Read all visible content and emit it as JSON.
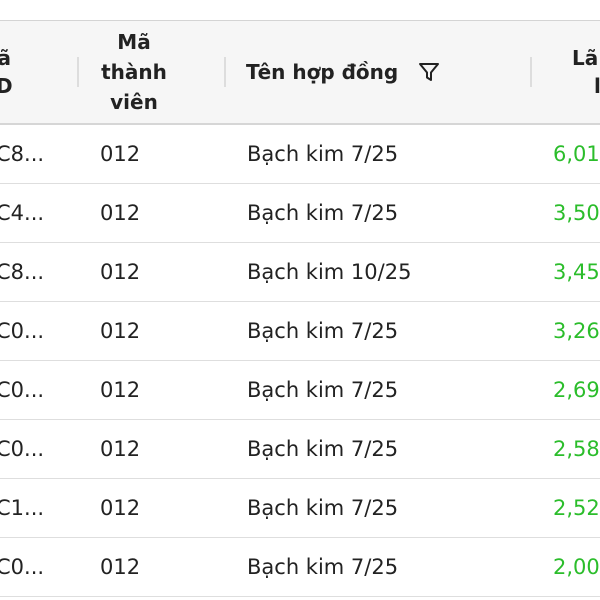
{
  "table": {
    "headers": {
      "col1_line1": "ã",
      "col1_line2": "D",
      "col2_lines": [
        "Mã",
        "thành",
        "viên"
      ],
      "col3": "Tên hợp đồng",
      "col4_line1": "Lã",
      "col4_line2": "l"
    },
    "rows": [
      {
        "id": "C8...",
        "member": "012",
        "contract": "Bạch kim 7/25",
        "profit": "6,01"
      },
      {
        "id": "C4...",
        "member": "012",
        "contract": "Bạch kim 7/25",
        "profit": "3,50"
      },
      {
        "id": "C8...",
        "member": "012",
        "contract": "Bạch kim 10/25",
        "profit": "3,45"
      },
      {
        "id": "C0...",
        "member": "012",
        "contract": "Bạch kim 7/25",
        "profit": "3,26"
      },
      {
        "id": "C0...",
        "member": "012",
        "contract": "Bạch kim 7/25",
        "profit": "2,69"
      },
      {
        "id": "C0...",
        "member": "012",
        "contract": "Bạch kim 7/25",
        "profit": "2,58"
      },
      {
        "id": "C1...",
        "member": "012",
        "contract": "Bạch kim 7/25",
        "profit": "2,52"
      },
      {
        "id": "C0...",
        "member": "012",
        "contract": "Bạch kim 7/25",
        "profit": "2,00"
      }
    ]
  },
  "colors": {
    "profit_positive": "#2bbd2b",
    "header_bg": "#f6f6f6",
    "row_border": "#dedede"
  },
  "icons": {
    "filter": "filter-funnel-icon"
  }
}
